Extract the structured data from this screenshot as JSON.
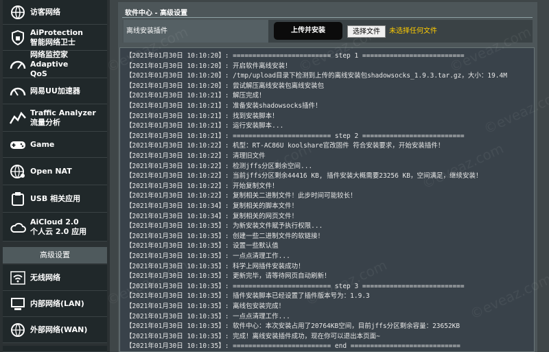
{
  "sidebar": {
    "items": [
      {
        "label": "访客网络",
        "label2": "",
        "icon": "guest-network-icon"
      },
      {
        "label": "AiProtection",
        "label2": "智能网络卫士",
        "icon": "shield-icon"
      },
      {
        "label": "网络监控家 Adaptive",
        "label2": "QoS",
        "icon": "gauge-icon"
      },
      {
        "label": "网易UU加速器",
        "label2": "",
        "icon": "speedometer-icon"
      },
      {
        "label": "Traffic Analyzer",
        "label2": "流量分析",
        "icon": "chart-line-icon"
      },
      {
        "label": "Game",
        "label2": "",
        "icon": "gamepad-icon"
      },
      {
        "label": "Open NAT",
        "label2": "",
        "icon": "globe-icon"
      },
      {
        "label": "USB 相关应用",
        "label2": "",
        "icon": "usb-icon"
      },
      {
        "label": "AiCloud 2.0",
        "label2": "个人云 2.0 应用",
        "icon": "cloud-icon"
      }
    ],
    "advanced_header": "高级设置",
    "advanced_items": [
      {
        "label": "无线网络",
        "icon": "wifi-icon"
      },
      {
        "label": "内部网络(LAN)",
        "icon": "lan-icon"
      },
      {
        "label": "外部网络(WAN)",
        "icon": "wan-globe-icon"
      }
    ]
  },
  "main": {
    "title": "软件中心 - 高级设置",
    "plugin_label": "离线安装插件",
    "upload_button": "上传并安装",
    "file_button": "选择文件",
    "file_status": "未选择任何文件"
  },
  "log": [
    "【2021年01月30日 10:10:20】: ========================= step 1 ==========================",
    "【2021年01月30日 10:10:20】: 开启软件离线安装！",
    "【2021年01月30日 10:10:20】: /tmp/upload目录下检测到上传的离线安装包shadowsocks_1.9.3.tar.gz，大小：19.4M",
    "【2021年01月30日 10:10:20】: 尝试解压离线安装包离线安装包",
    "【2021年01月30日 10:10:21】: 解压完成！",
    "【2021年01月30日 10:10:21】: 准备安装shadowsocks插件！",
    "【2021年01月30日 10:10:21】: 找到安装脚本！",
    "【2021年01月30日 10:10:21】: 运行安装脚本...",
    "【2021年01月30日 10:10:21】: ========================= step 2 ==========================",
    "【2021年01月30日 10:10:22】: 机型：RT-AC86U koolshare官改固件 符合安装要求，开始安装插件！",
    "【2021年01月30日 10:10:22】: 清理旧文件",
    "【2021年01月30日 10:10:22】: 检测jffs分区剩余空间...",
    "【2021年01月30日 10:10:22】: 当前jffs分区剩余44416 KB, 插件安装大概需要23256 KB，空间满足，继续安装！",
    "【2021年01月30日 10:10:22】: 开始复制文件！",
    "【2021年01月30日 10:10:22】: 复制相关二进制文件！此步时间可能较长！",
    "【2021年01月30日 10:10:34】: 复制相关的脚本文件！",
    "【2021年01月30日 10:10:34】: 复制相关的网页文件！",
    "【2021年01月30日 10:10:35】: 为新安装文件赋予执行权限...",
    "【2021年01月30日 10:10:35】: 创建一些二进制文件的软链接！",
    "【2021年01月30日 10:10:35】: 设置一些默认值",
    "【2021年01月30日 10:10:35】: 一点点清理工作...",
    "【2021年01月30日 10:10:35】: 科学上网插件安装成功！",
    "【2021年01月30日 10:10:35】: 更新完毕，请等待网页自动刷新！",
    "【2021年01月30日 10:10:35】: ========================= step 3 ==========================",
    "【2021年01月30日 10:10:35】: 插件安装脚本已经设置了插件版本号为：1.9.3",
    "【2021年01月30日 10:10:35】: 离线包安装完成！",
    "【2021年01月30日 10:10:35】: 一点点清理工作...",
    "【2021年01月30日 10:10:35】: 软件中心：本次安装占用了20764KB空间，目前jffs分区剩余容量：23652KB",
    "【2021年01月30日 10:10:35】: 完成！离线安装插件成功，现在你可以退出本页面~",
    "【2021年01月30日 10:10:35】: ========================= end ============================"
  ],
  "watermark": "©eveaz.com"
}
